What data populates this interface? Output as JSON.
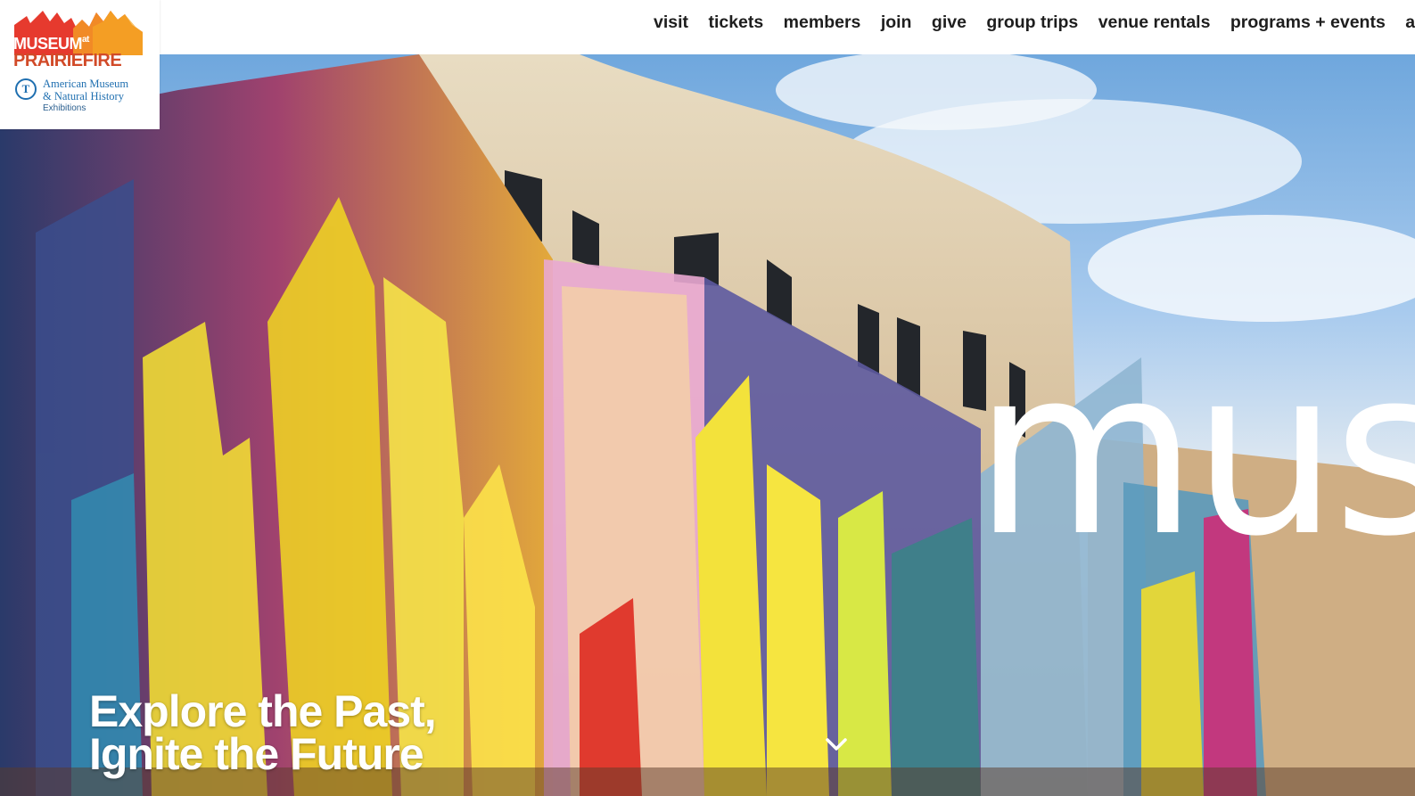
{
  "logo": {
    "line1": "MUSEUM",
    "line1_at": "at",
    "line2": "PRAIRIEFIRE",
    "partner_lines": [
      "American Museum",
      "& Natural History"
    ],
    "partner_sub": "Exhibitions",
    "colors": {
      "orange": "#f08a24",
      "red": "#e03a2f",
      "partner_blue": "#1f6fb0"
    }
  },
  "nav": {
    "items": [
      "visit",
      "tickets",
      "members",
      "join",
      "give",
      "group trips",
      "venue rentals",
      "programs + events",
      "about"
    ]
  },
  "hero": {
    "word": "mus",
    "tagline_line1": "Explore the Past,",
    "tagline_line2": "Ignite the Future",
    "scroll_icon": "chevron-down-icon"
  }
}
